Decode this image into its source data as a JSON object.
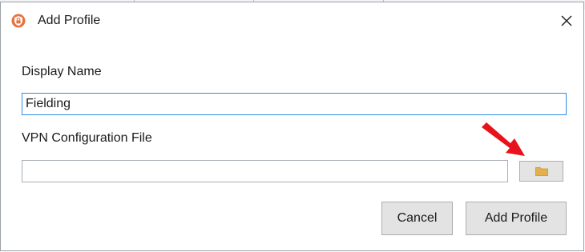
{
  "window": {
    "title": "Add Profile",
    "app_icon": "shield-lock-icon",
    "close_icon": "close-icon",
    "close_glyph": "✕"
  },
  "form": {
    "display_name_label": "Display Name",
    "display_name_value": "Fielding",
    "vpn_file_label": "VPN Configuration File",
    "vpn_file_value": "",
    "browse_icon": "folder-icon"
  },
  "buttons": {
    "cancel_label": "Cancel",
    "add_label": "Add Profile"
  },
  "annotation": {
    "arrow_icon": "red-arrow-icon"
  },
  "colors": {
    "accent_icon": "#e8713c",
    "focus_border": "#2f8be5",
    "arrow": "#e8121b",
    "folder": "#e3b04b"
  }
}
